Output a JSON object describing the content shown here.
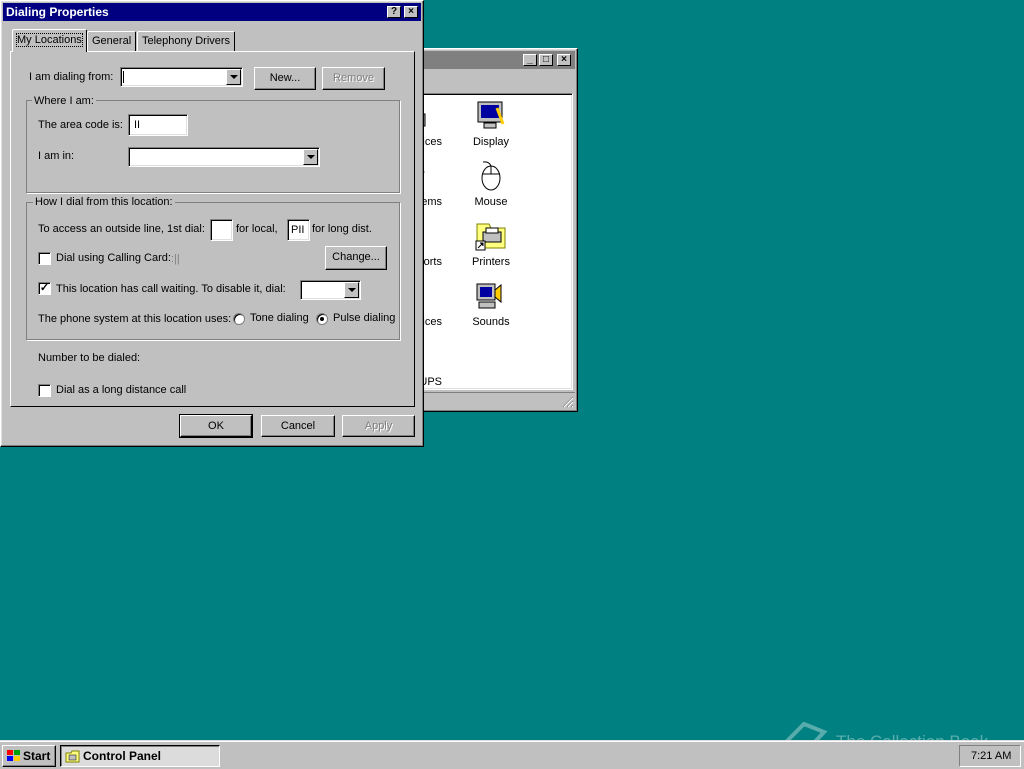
{
  "dialog": {
    "title": "Dialing Properties",
    "help_btn": "?",
    "close_btn": "×",
    "tabs": [
      "My Locations",
      "General",
      "Telephony Drivers"
    ],
    "dialing_from_label": "I am dialing from:",
    "dialing_from_value": "",
    "new_button": "New...",
    "remove_button": "Remove",
    "where_group": "Where I am:",
    "area_code_label": "The area code is:",
    "area_code_value": "II",
    "i_am_in_label": "I am in:",
    "i_am_in_value": "",
    "how_group": "How I dial from this location:",
    "outside_line_label": "To access an outside line, 1st dial:",
    "local_value": "",
    "for_local_label": "for local,",
    "long_dist_value": "PII",
    "for_long_dist_label": "for long dist.",
    "calling_card_label": "Dial using Calling Card:",
    "calling_card_checked": false,
    "calling_card_value": ":||",
    "change_button": "Change...",
    "call_waiting_label": "This location has call waiting. To disable it, dial:",
    "call_waiting_checked": true,
    "call_waiting_value": "",
    "phone_system_label": "The phone system at this location uses:",
    "tone_label": "Tone dialing",
    "pulse_label": "Pulse dialing",
    "selected_dialing": "pulse",
    "number_to_dial_label": "Number to be dialed:",
    "long_distance_label": "Dial as a long distance call",
    "long_distance_checked": false,
    "ok_button": "OK",
    "cancel_button": "Cancel",
    "apply_button": "Apply"
  },
  "control_panel_window": {
    "items": [
      {
        "label": "Services",
        "visible_label": "evices",
        "icon": "keyboard-icon"
      },
      {
        "label": "Display",
        "visible_label": "Display",
        "icon": "monitor-icon"
      },
      {
        "label": "Modems",
        "visible_label": "odems",
        "icon": "phone-icon"
      },
      {
        "label": "Mouse",
        "visible_label": "Mouse",
        "icon": "mouse-icon"
      },
      {
        "label": "Ports",
        "visible_label": "orts",
        "icon": "port-icon"
      },
      {
        "label": "Printers",
        "visible_label": "Printers",
        "icon": "printer-icon"
      },
      {
        "label": "Services",
        "visible_label": "rvices",
        "icon": "gear-icon"
      },
      {
        "label": "Sounds",
        "visible_label": "Sounds",
        "icon": "speaker-icon"
      },
      {
        "label": "UPS",
        "visible_label": "UPS",
        "icon": "battery-icon"
      }
    ]
  },
  "taskbar": {
    "start_label": "Start",
    "task_label": "Control Panel",
    "clock": "7:21 AM"
  },
  "watermark": "The Collection Book"
}
